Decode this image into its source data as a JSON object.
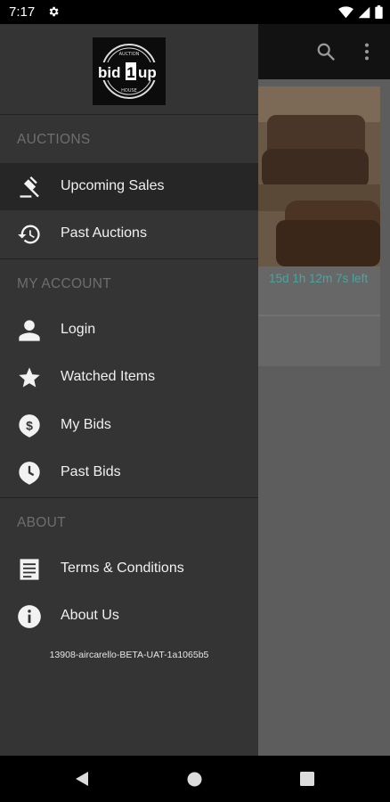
{
  "status_bar": {
    "time": "7:17"
  },
  "logo": {
    "top_text": "AUCTION",
    "main_text_left": "bid",
    "main_text_num": "1",
    "main_text_right": "up",
    "bottom_text": "HOUSE"
  },
  "background": {
    "time_left": "15d 1h 12m 7s left"
  },
  "drawer": {
    "sections": [
      {
        "title": "AUCTIONS",
        "items": [
          {
            "label": "Upcoming Sales",
            "icon": "gavel-icon",
            "active": true
          },
          {
            "label": "Past Auctions",
            "icon": "history-icon"
          }
        ]
      },
      {
        "title": "MY ACCOUNT",
        "items": [
          {
            "label": "Login",
            "icon": "person-icon"
          },
          {
            "label": "Watched Items",
            "icon": "star-icon"
          },
          {
            "label": "My Bids",
            "icon": "dollar-pin-icon"
          },
          {
            "label": "Past Bids",
            "icon": "clock-pin-icon"
          }
        ]
      },
      {
        "title": "ABOUT",
        "items": [
          {
            "label": "Terms & Conditions",
            "icon": "document-icon"
          },
          {
            "label": "About Us",
            "icon": "info-icon"
          }
        ]
      }
    ],
    "version": "13908-aircarello-BETA-UAT-1a1065b5"
  },
  "colors": {
    "drawer_bg": "#343434",
    "active_item_bg": "#262626",
    "accent_teal": "#4aa5a0",
    "scrim": "#5d5d5d"
  }
}
